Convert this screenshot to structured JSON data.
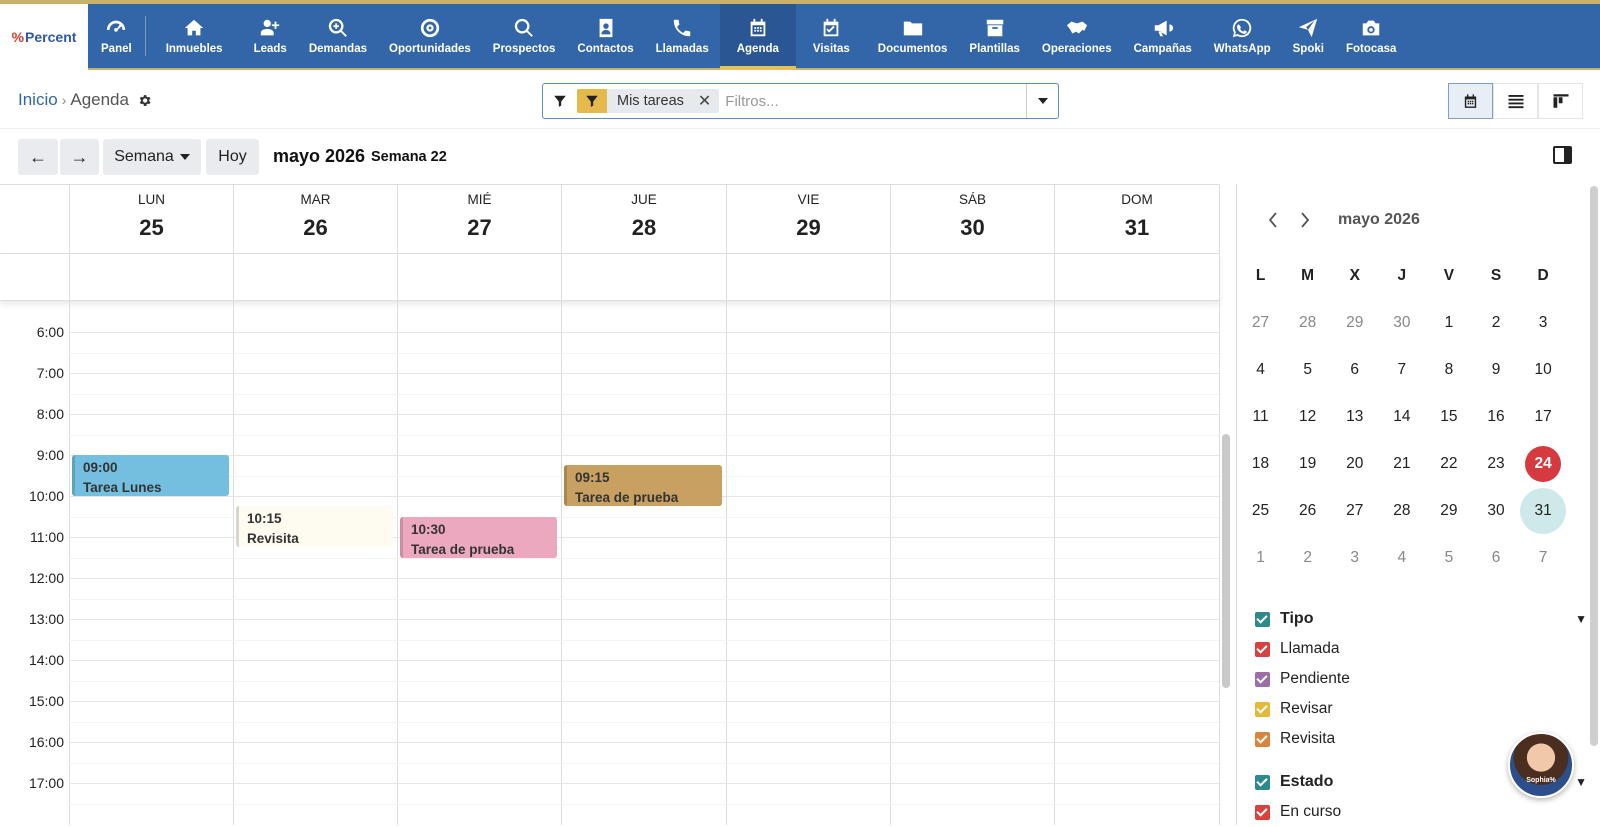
{
  "logo": {
    "mark": "%",
    "text": "Percent"
  },
  "nav": [
    {
      "label": "Panel",
      "icon": "dashboard-icon"
    },
    {
      "label": "Inmuebles",
      "icon": "home-icon"
    },
    {
      "label": "Leads",
      "icon": "user-plus-icon"
    },
    {
      "label": "Demandas",
      "icon": "search-plus-icon"
    },
    {
      "label": "Oportunidades",
      "icon": "target-icon"
    },
    {
      "label": "Prospectos",
      "icon": "search-icon"
    },
    {
      "label": "Contactos",
      "icon": "address-book-icon"
    },
    {
      "label": "Llamadas",
      "icon": "phone-icon"
    },
    {
      "label": "Agenda",
      "icon": "calendar-icon",
      "active": true
    },
    {
      "label": "Visitas",
      "icon": "calendar-check-icon"
    },
    {
      "label": "Documentos",
      "icon": "folder-icon"
    },
    {
      "label": "Plantillas",
      "icon": "archive-icon"
    },
    {
      "label": "Operaciones",
      "icon": "handshake-icon"
    },
    {
      "label": "Campañas",
      "icon": "megaphone-icon"
    },
    {
      "label": "WhatsApp",
      "icon": "whatsapp-icon"
    },
    {
      "label": "Spoki",
      "icon": "paper-plane-icon"
    },
    {
      "label": "Fotocasa",
      "icon": "camera-icon"
    }
  ],
  "breadcrumb": {
    "home": "Inicio",
    "sep": "›",
    "current": "Agenda"
  },
  "filter": {
    "chip": "Mis tareas",
    "placeholder": "Filtros..."
  },
  "toolbar": {
    "prev": "←",
    "next": "→",
    "view": "Semana",
    "today": "Hoy",
    "month": "mayo 2026",
    "week": "Semana 22"
  },
  "days": [
    {
      "name": "LUN",
      "num": "25"
    },
    {
      "name": "MAR",
      "num": "26"
    },
    {
      "name": "MIÉ",
      "num": "27"
    },
    {
      "name": "JUE",
      "num": "28"
    },
    {
      "name": "VIE",
      "num": "29"
    },
    {
      "name": "SÁB",
      "num": "30"
    },
    {
      "name": "DOM",
      "num": "31"
    }
  ],
  "hours": [
    "6:00",
    "7:00",
    "8:00",
    "9:00",
    "10:00",
    "11:00",
    "12:00",
    "13:00",
    "14:00",
    "15:00",
    "16:00",
    "17:00"
  ],
  "events": [
    {
      "day": 0,
      "time": "09:00",
      "title": "Tarea Lunes",
      "color": "#74bfe0"
    },
    {
      "day": 1,
      "time": "10:15",
      "title": "Revisita",
      "color": "#fefcf1"
    },
    {
      "day": 2,
      "time": "10:30",
      "title": "Tarea de prueba",
      "color": "#eba8bf"
    },
    {
      "day": 3,
      "time": "09:15",
      "title": "Tarea de prueba",
      "color": "#c7a062"
    }
  ],
  "mini": {
    "title": "mayo 2026",
    "weekdays": [
      "L",
      "M",
      "X",
      "J",
      "V",
      "S",
      "D"
    ],
    "weeks": [
      [
        "27",
        "28",
        "29",
        "30",
        "1",
        "2",
        "3"
      ],
      [
        "4",
        "5",
        "6",
        "7",
        "8",
        "9",
        "10"
      ],
      [
        "11",
        "12",
        "13",
        "14",
        "15",
        "16",
        "17"
      ],
      [
        "18",
        "19",
        "20",
        "21",
        "22",
        "23",
        "24"
      ],
      [
        "25",
        "26",
        "27",
        "28",
        "29",
        "30",
        "31"
      ],
      [
        "1",
        "2",
        "3",
        "4",
        "5",
        "6",
        "7"
      ]
    ],
    "today": "24",
    "selected": "31"
  },
  "legend": {
    "tipo": {
      "label": "Tipo",
      "color": "#2e8a8a",
      "items": [
        {
          "label": "Llamada",
          "color": "#d94040"
        },
        {
          "label": "Pendiente",
          "color": "#9b6fa5"
        },
        {
          "label": "Revisar",
          "color": "#e5b93a"
        },
        {
          "label": "Revisita",
          "color": "#d9853f"
        }
      ]
    },
    "estado": {
      "label": "Estado",
      "color": "#2e8a8a",
      "items": [
        {
          "label": "En curso",
          "color": "#d94040"
        }
      ]
    }
  },
  "assistant": {
    "name": "Sophia%"
  }
}
